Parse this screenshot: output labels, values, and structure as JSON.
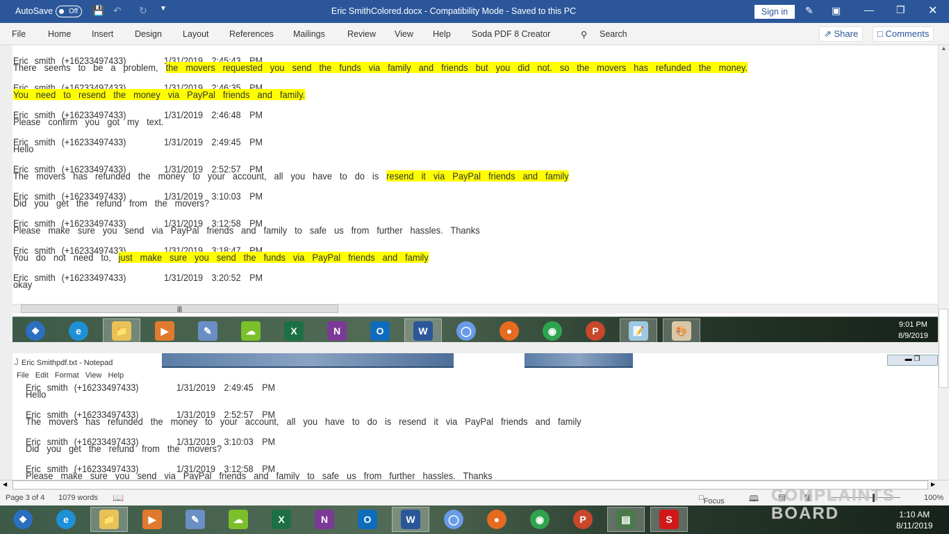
{
  "titlebar": {
    "autosave": "AutoSave",
    "autosave_state": "Off",
    "title": "Eric SmithColored.docx  -  Compatibility Mode  -  Saved to this PC",
    "sign_in": "Sign in"
  },
  "ribbon": {
    "tabs": [
      "File",
      "Home",
      "Insert",
      "Design",
      "Layout",
      "References",
      "Mailings",
      "Review",
      "View",
      "Help",
      "Soda PDF 8 Creator"
    ],
    "search": "Search",
    "share": "Share",
    "comments": "Comments"
  },
  "document": {
    "sender": "Eric  smith  (+16233497433)",
    "entries": [
      {
        "date": "1/31/2019  2:45:43  PM",
        "msg": [
          {
            "t": "There seems to be a problem, ",
            "hl": false
          },
          {
            "t": "the movers requested you send the funds via family and friends but you did not. so the movers has refunded the money.",
            "hl": true
          }
        ]
      },
      {
        "date": "1/31/2019  2:46:35  PM",
        "msg": [
          {
            "t": "You need to resend the money via PayPal friends and family.",
            "hl": true
          }
        ]
      },
      {
        "date": "1/31/2019  2:46:48  PM",
        "msg": [
          {
            "t": "Please confirm you got my text.",
            "hl": false
          }
        ]
      },
      {
        "date": "1/31/2019  2:49:45  PM",
        "msg": [
          {
            "t": "Hello",
            "hl": false
          }
        ]
      },
      {
        "date": "1/31/2019  2:52:57  PM",
        "msg": [
          {
            "t": "The movers has refunded the money to your account, all you have to do is ",
            "hl": false
          },
          {
            "t": "resend it via PayPal friends and family",
            "hl": true
          }
        ]
      },
      {
        "date": "1/31/2019  3:10:03  PM",
        "msg": [
          {
            "t": "Did you get the refund from the movers?",
            "hl": false
          }
        ]
      },
      {
        "date": "1/31/2019  3:12:58  PM",
        "msg": [
          {
            "t": "Please make sure you send via PayPal friends and family to safe us from further hassles.  Thanks",
            "hl": false
          }
        ]
      },
      {
        "date": "1/31/2019  3:18:47  PM",
        "msg": [
          {
            "t": "You do not need to, ",
            "hl": false
          },
          {
            "t": "just make sure you send the funds via PayPal friends and family",
            "hl": true
          }
        ]
      },
      {
        "date": "1/31/2019  3:20:52  PM",
        "msg": [
          {
            "t": "okay",
            "hl": false
          }
        ]
      }
    ]
  },
  "embedded_taskbar": {
    "time": "9:01 PM",
    "date": "8/9/2019"
  },
  "notepad": {
    "title": "Eric Smithpdf.txt  - Notepad",
    "menu": [
      "File",
      "Edit",
      "Format",
      "View",
      "Help"
    ],
    "entries": [
      {
        "date": "1/31/2019  2:49:45  PM",
        "msg": [
          {
            "t": "Hello",
            "hl": false
          }
        ]
      },
      {
        "date": "1/31/2019  2:52:57  PM",
        "msg": [
          {
            "t": "The movers has refunded the money to your account, all you have to do is resend it via PayPal friends and family",
            "hl": false
          }
        ]
      },
      {
        "date": "1/31/2019  3:10:03  PM",
        "msg": [
          {
            "t": "Did you get the refund from the movers?",
            "hl": false
          }
        ]
      },
      {
        "date": "1/31/2019  3:12:58  PM",
        "msg": [
          {
            "t": "Please make sure you send via PayPal friends and family to safe us from further hassles.  Thanks",
            "hl": false
          }
        ]
      }
    ]
  },
  "statusbar": {
    "page": "Page 3 of 4",
    "words": "1079 words",
    "focus": "Focus",
    "zoom": "100%"
  },
  "taskbar": {
    "time": "1:10 AM",
    "date": "8/11/2019"
  },
  "watermark": "COMPLAINTS BOARD",
  "colors": {
    "word_blue": "#2b579a",
    "highlight": "#ffff00"
  }
}
